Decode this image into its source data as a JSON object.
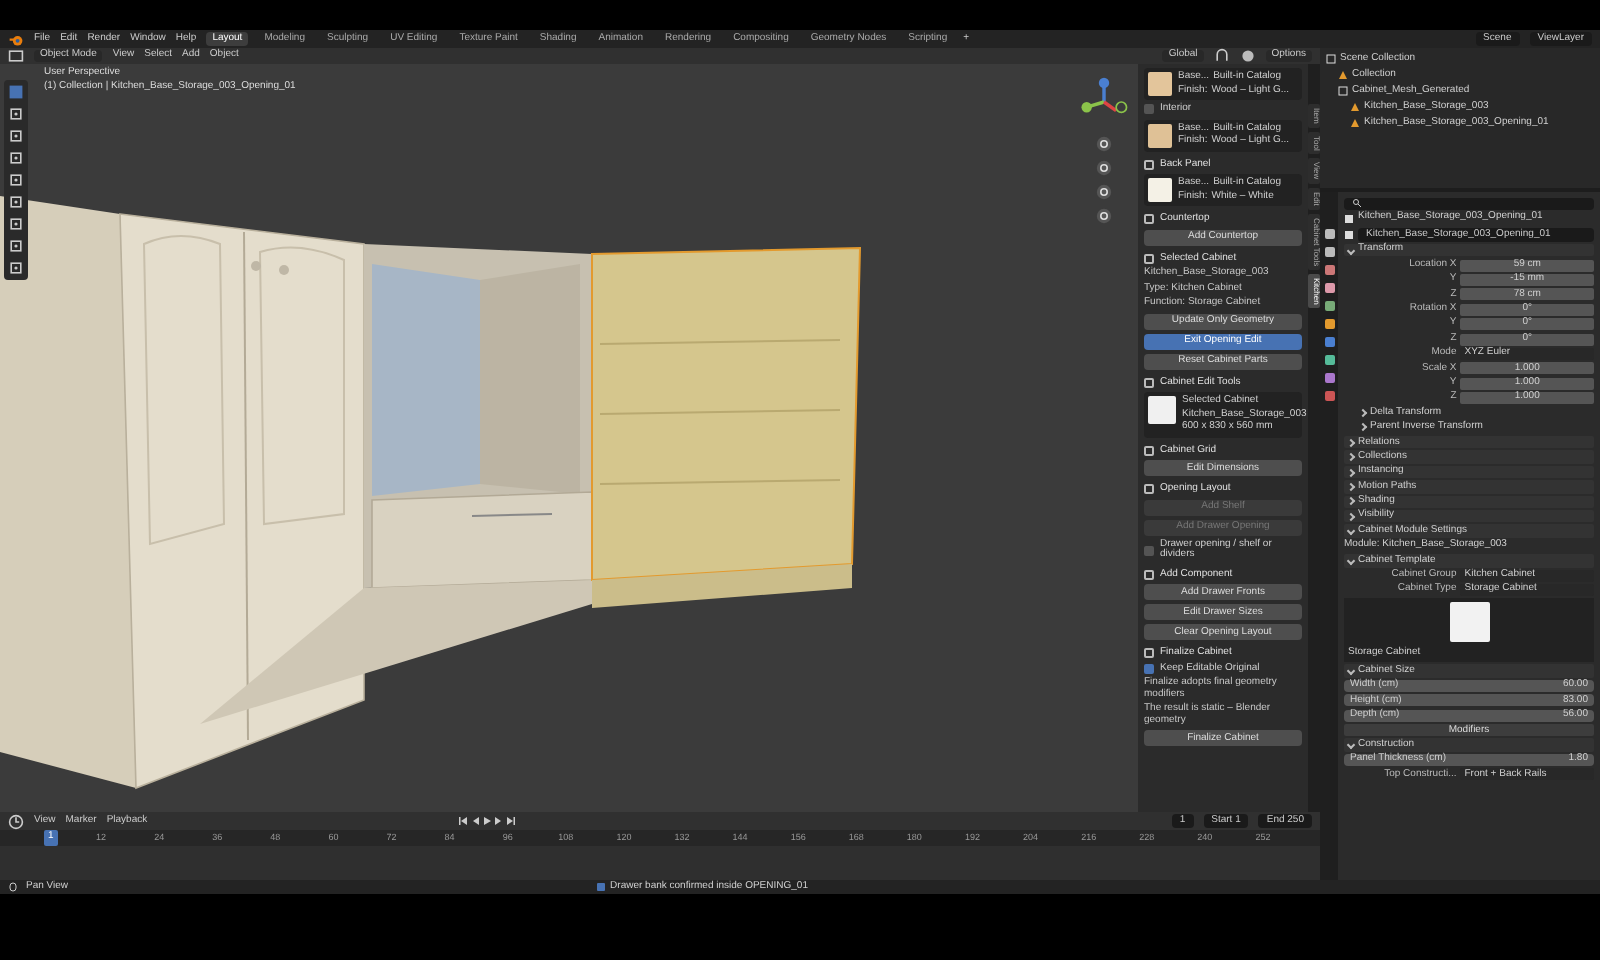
{
  "menu_bar": {
    "menus": [
      "File",
      "Edit",
      "Render",
      "Window",
      "Help"
    ],
    "workspaces": [
      {
        "label": "Layout",
        "selected": true
      },
      {
        "label": "Modeling",
        "selected": false
      },
      {
        "label": "Sculpting",
        "selected": false
      },
      {
        "label": "UV Editing",
        "selected": false
      },
      {
        "label": "Texture Paint",
        "selected": false
      },
      {
        "label": "Shading",
        "selected": false
      },
      {
        "label": "Animation",
        "selected": false
      },
      {
        "label": "Rendering",
        "selected": false
      },
      {
        "label": "Compositing",
        "selected": false
      },
      {
        "label": "Geometry Nodes",
        "selected": false
      },
      {
        "label": "Scripting",
        "selected": false
      }
    ],
    "add_tab": "+",
    "scene": "Scene",
    "view_layer": "ViewLayer"
  },
  "viewport_header": {
    "mode": "Object Mode",
    "menus": [
      "View",
      "Select",
      "Add",
      "Object"
    ],
    "orientation": "Global",
    "options": "Options"
  },
  "viewport": {
    "view_name": "User Perspective",
    "collection": "(1) Collection | Kitchen_Base_Storage_003_Opening_01"
  },
  "sidebar": {
    "tabs": [
      {
        "label": "Item",
        "selected": false
      },
      {
        "label": "Tool",
        "selected": false
      },
      {
        "label": "View",
        "selected": false
      },
      {
        "label": "Edit",
        "selected": false
      },
      {
        "label": "Cabinet Tools",
        "selected": false
      },
      {
        "label": "Kitchen",
        "selected": true
      }
    ],
    "items": [
      {
        "kind": "material",
        "name": "Base...",
        "catalog": "Built-in Catalog",
        "finish_label": "Finish:",
        "finish": "Wood – Light G...",
        "color": "#e3c59b"
      },
      {
        "kind": "checkbox",
        "label": "Interior",
        "checked": false
      },
      {
        "kind": "material",
        "name": "Base...",
        "catalog": "Built-in Catalog",
        "finish_label": "Finish:",
        "finish": "Wood – Light G...",
        "color": "#dfc196"
      },
      {
        "kind": "heading",
        "label": "Back Panel"
      },
      {
        "kind": "material",
        "name": "Base...",
        "catalog": "Built-in Catalog",
        "finish_label": "Finish:",
        "finish": "White – White",
        "color": "#f4f1e6"
      },
      {
        "kind": "heading",
        "label": "Countertop"
      },
      {
        "kind": "button",
        "label": "Add Countertop",
        "selected": false,
        "disabled": false
      },
      {
        "kind": "heading",
        "label": "Selected Cabinet"
      },
      {
        "kind": "text",
        "label": "Kitchen_Base_Storage_003"
      },
      {
        "kind": "text",
        "label": "Type: Kitchen Cabinet"
      },
      {
        "kind": "text",
        "label": "Function: Storage Cabinet"
      },
      {
        "kind": "button",
        "label": "Update Only Geometry",
        "selected": false,
        "disabled": false
      },
      {
        "kind": "button",
        "label": "Exit Opening Edit",
        "selected": true,
        "disabled": false
      },
      {
        "kind": "button",
        "label": "Reset Cabinet Parts",
        "selected": false,
        "disabled": false
      },
      {
        "kind": "heading",
        "label": "Cabinet Edit Tools"
      },
      {
        "kind": "card",
        "title": "Selected Cabinet",
        "name": "Kitchen_Base_Storage_003",
        "size": "600 x 830 x 560 mm"
      },
      {
        "kind": "heading",
        "label": "Cabinet Grid"
      },
      {
        "kind": "button",
        "label": "Edit Dimensions",
        "selected": false,
        "disabled": false
      },
      {
        "kind": "heading",
        "label": "Opening Layout"
      },
      {
        "kind": "button",
        "label": "Add Shelf",
        "selected": false,
        "disabled": true
      },
      {
        "kind": "button",
        "label": "Add Drawer Opening",
        "selected": false,
        "disabled": true
      },
      {
        "kind": "checkbox",
        "label": "Drawer opening / shelf or dividers",
        "checked": false
      },
      {
        "kind": "heading",
        "label": "Add Component"
      },
      {
        "kind": "button",
        "label": "Add Drawer Fronts",
        "selected": false,
        "disabled": false
      },
      {
        "kind": "button",
        "label": "Edit Drawer Sizes",
        "selected": false,
        "disabled": false
      },
      {
        "kind": "button",
        "label": "Clear Opening Layout",
        "selected": false,
        "disabled": false
      },
      {
        "kind": "heading",
        "label": "Finalize Cabinet"
      },
      {
        "kind": "checkbox",
        "label": "Keep Editable Original",
        "checked": true
      },
      {
        "kind": "text",
        "label": "Finalize adopts final geometry modifiers"
      },
      {
        "kind": "text",
        "label": "The result is static – Blender geometry"
      },
      {
        "kind": "button",
        "label": "Finalize Cabinet",
        "selected": false,
        "disabled": false
      }
    ]
  },
  "outliner": {
    "items": [
      {
        "label": "Scene Collection",
        "children": [
          {
            "label": "Collection"
          },
          {
            "label": "Cabinet_Mesh_Generated",
            "children": [
              {
                "label": "Kitchen_Base_Storage_003"
              },
              {
                "label": "Kitchen_Base_Storage_003_Opening_01"
              }
            ]
          }
        ]
      }
    ]
  },
  "properties": {
    "object_name": "Kitchen_Base_Storage_003_Opening_01",
    "data_name": "Kitchen_Base_Storage_003_Opening_01",
    "items": [
      {
        "kind": "panel",
        "label": "Transform",
        "expanded": true
      },
      {
        "kind": "prop",
        "label": "Location X",
        "value": "59 cm"
      },
      {
        "kind": "prop",
        "label": "Y",
        "value": "-15 mm"
      },
      {
        "kind": "prop",
        "label": "Z",
        "value": "78 cm"
      },
      {
        "kind": "prop",
        "label": "Rotation X",
        "value": "0°"
      },
      {
        "kind": "prop",
        "label": "Y",
        "value": "0°"
      },
      {
        "kind": "prop",
        "label": "Z",
        "value": "0°"
      },
      {
        "kind": "dropdown",
        "label": "Mode",
        "value": "XYZ Euler"
      },
      {
        "kind": "prop",
        "label": "Scale X",
        "value": "1.000"
      },
      {
        "kind": "prop",
        "label": "Y",
        "value": "1.000"
      },
      {
        "kind": "prop",
        "label": "Z",
        "value": "1.000"
      },
      {
        "kind": "subpanel",
        "label": "Delta Transform",
        "expanded": false
      },
      {
        "kind": "subpanel",
        "label": "Parent Inverse Transform",
        "expanded": false
      },
      {
        "kind": "panel",
        "label": "Relations",
        "expanded": false
      },
      {
        "kind": "panel",
        "label": "Collections",
        "expanded": false
      },
      {
        "kind": "panel",
        "label": "Instancing",
        "expanded": false
      },
      {
        "kind": "panel",
        "label": "Motion Paths",
        "expanded": false
      },
      {
        "kind": "panel",
        "label": "Shading",
        "expanded": false
      },
      {
        "kind": "panel",
        "label": "Visibility",
        "expanded": false
      },
      {
        "kind": "panel",
        "label": "Cabinet Module Settings",
        "expanded": true
      },
      {
        "kind": "text",
        "label": "Module: Kitchen_Base_Storage_003"
      },
      {
        "kind": "panel",
        "label": "Cabinet Template",
        "expanded": true
      },
      {
        "kind": "choice",
        "label": "Cabinet Group",
        "value": "Kitchen Cabinet"
      },
      {
        "kind": "choice",
        "label": "Cabinet Type",
        "value": "Storage Cabinet"
      },
      {
        "kind": "preview",
        "label": "Storage Cabinet"
      },
      {
        "kind": "panel",
        "label": "Cabinet Size",
        "expanded": true
      },
      {
        "kind": "slider",
        "label": "Width (cm)",
        "value": "60.00"
      },
      {
        "kind": "slider",
        "label": "Height (cm)",
        "value": "83.00"
      },
      {
        "kind": "slider",
        "label": "Depth (cm)",
        "value": "56.00"
      },
      {
        "kind": "button",
        "label": "Modifiers"
      },
      {
        "kind": "panel",
        "label": "Construction",
        "expanded": true
      },
      {
        "kind": "slider",
        "label": "Panel Thickness (cm)",
        "value": "1.80"
      },
      {
        "kind": "dropdown",
        "label": "Top Constructi...",
        "value": "Front + Back Rails"
      }
    ]
  },
  "timeline": {
    "menus": [
      "View",
      "Marker",
      "Playback"
    ],
    "current_frame": "1",
    "start_label": "Start",
    "start": "1",
    "end_label": "End",
    "end": "250",
    "playhead": "1",
    "ticks": [
      "12",
      "24",
      "36",
      "48",
      "60",
      "72",
      "84",
      "96",
      "108",
      "120",
      "132",
      "144",
      "156",
      "168",
      "180",
      "192",
      "204",
      "216",
      "228",
      "240",
      "252"
    ]
  },
  "status_bar": {
    "hint": "Pan View",
    "message": "Drawer bank confirmed inside OPENING_01"
  }
}
